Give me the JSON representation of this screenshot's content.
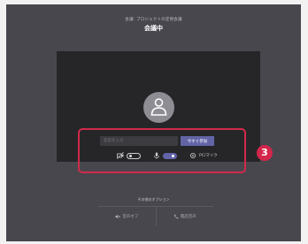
{
  "header": {
    "subtitle": "会議: プロジェクトの定例会議",
    "title": "会議中"
  },
  "preview": {
    "name_placeholder": "名前を入力",
    "join_label": "今すぐ参加",
    "camera_toggle": "off",
    "mic_toggle": "on",
    "device_settings_label": "PC/マイク"
  },
  "callout": {
    "number": "3",
    "color": "#d3264a"
  },
  "other_options": {
    "label": "その他のオプション",
    "audio_off_label": "音声オフ",
    "phone_audio_label": "電話音声"
  },
  "colors": {
    "background": "#48474e",
    "preview": "#262629",
    "accent": "#6264a7",
    "highlight": "#d12a4a"
  }
}
